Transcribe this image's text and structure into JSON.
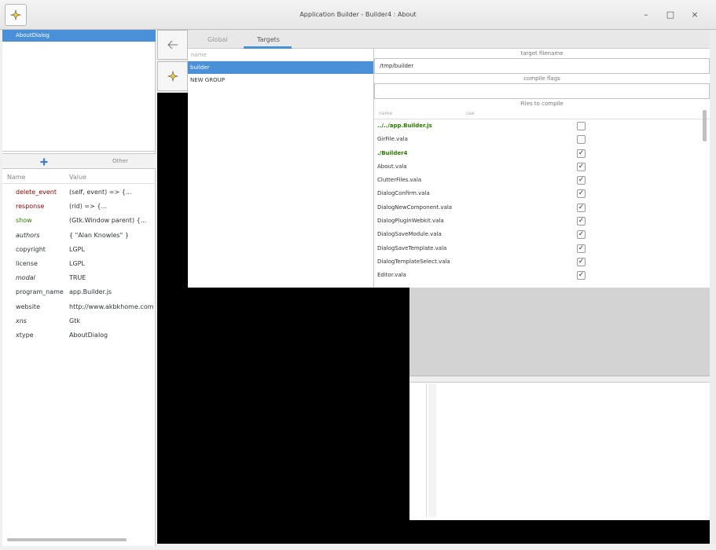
{
  "window": {
    "title": "Application Builder - Builder4 : About",
    "minimize_glyph": "–",
    "maximize_glyph": "□",
    "close_glyph": "×"
  },
  "tree": {
    "items": [
      {
        "label": "AboutDialog"
      }
    ]
  },
  "property_tabs": {
    "add_icon": "plus-icon",
    "other_label": "Other"
  },
  "properties": {
    "col_name": "Name",
    "col_value": "Value",
    "rows": [
      {
        "key": "delete_event",
        "value": "(self, event) => {..."
      },
      {
        "key": "response",
        "value": "(rid) => {..."
      },
      {
        "key": "show",
        "value": "(Gtk.Window parent) {..."
      },
      {
        "key": "authors",
        "value": "{ \"Alan Knowles\" }"
      },
      {
        "key": "copyright",
        "value": "LGPL"
      },
      {
        "key": "license",
        "value": "LGPL"
      },
      {
        "key": "modal",
        "value": "TRUE"
      },
      {
        "key": "program_name",
        "value": "app.Builder.js"
      },
      {
        "key": "website",
        "value": "http://www.akbkhome.com"
      },
      {
        "key": "xns",
        "value": "Gtk"
      },
      {
        "key": "xtype",
        "value": "AboutDialog"
      }
    ]
  },
  "main_tabs": {
    "global": "Global",
    "targets": "Targets"
  },
  "targets": {
    "col_name": "name",
    "rows": [
      {
        "label": "builder"
      },
      {
        "label": "NEW GROUP"
      }
    ]
  },
  "target_config": {
    "filename_label": "target filename",
    "filename_value": "/tmp/builder",
    "flags_label": "compile flags",
    "flags_value": "",
    "files_label": "Files to compile",
    "col_name": "name",
    "col_use": "use",
    "files": [
      {
        "name": "../../app.Builder.js",
        "checked": false
      },
      {
        "name": "GirFile.vala",
        "checked": false
      },
      {
        "name": "./Builder4",
        "checked": true
      },
      {
        "name": "About.vala",
        "checked": true
      },
      {
        "name": "ClutterFiles.vala",
        "checked": true
      },
      {
        "name": "DialogConfirm.vala",
        "checked": true
      },
      {
        "name": "DialogNewComponent.vala",
        "checked": true
      },
      {
        "name": "DialogPluginWebkit.vala",
        "checked": true
      },
      {
        "name": "DialogSaveModule.vala",
        "checked": true
      },
      {
        "name": "DialogSaveTemplate.vala",
        "checked": true
      },
      {
        "name": "DialogTemplateSelect.vala",
        "checked": true
      },
      {
        "name": "Editor.vala",
        "checked": true
      }
    ]
  }
}
